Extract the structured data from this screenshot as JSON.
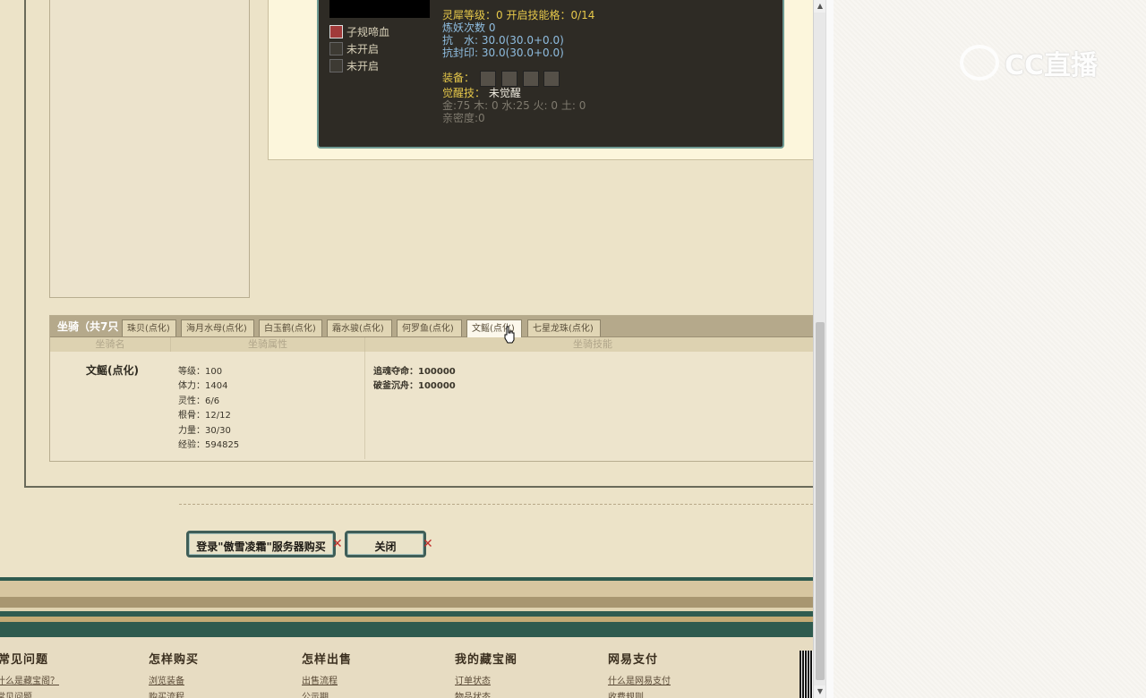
{
  "pet": {
    "skills": [
      {
        "label": "子规啼血",
        "icon": "blood-skill-icon"
      },
      {
        "label": "未开启",
        "icon": "locked-slot-icon"
      },
      {
        "label": "未开启",
        "icon": "locked-slot-icon"
      }
    ],
    "lingxi": "灵犀等级：0 开启技能格：0/14",
    "lianyao": "炼妖次数 0",
    "kang_shui_label": "抗　水:",
    "kang_shui_value": "30.0(30.0+0.0)",
    "kang_feng_label": "抗封印:",
    "kang_feng_value": "30.0(30.0+0.0)",
    "equip_label": "装备：",
    "awaken_label": "觉醒技：",
    "awaken_value": "未觉醒",
    "elements": "金:75 木: 0 水:25 火: 0 土: 0",
    "intimacy": "亲密度:0"
  },
  "mounts": {
    "section_title": "坐骑（共7只",
    "tabs": [
      "珠贝(点化)",
      "海月水母(点化)",
      "白玉鹤(点化)",
      "霜水骏(点化)",
      "何罗鱼(点化)",
      "文鳐(点化)",
      "七星龙珠(点化)"
    ],
    "active_tab": "文鳐(点化)",
    "col_name": "坐骑名",
    "col_attrs": "坐骑属性",
    "col_skills": "坐骑技能",
    "selected": {
      "name": "文鳐(点化)",
      "attrs": [
        "等级：100",
        "体力：1404",
        "灵性：6/6",
        "根骨：12/12",
        "力量：30/30",
        "经验：594825"
      ],
      "skills": [
        "追魂夺命：100000",
        "破釜沉舟：100000"
      ]
    }
  },
  "buttons": {
    "login_buy": "登录\"傲雪凌霜\"服务器购买",
    "close": "关闭"
  },
  "footer": {
    "columns": [
      {
        "head": "常见问题",
        "links": [
          "什么是藏宝阁？",
          "常见问题"
        ]
      },
      {
        "head": "怎样购买",
        "links": [
          "浏览装备",
          "购买流程"
        ]
      },
      {
        "head": "怎样出售",
        "links": [
          "出售流程",
          "公示期"
        ]
      },
      {
        "head": "我的藏宝阁",
        "links": [
          "订单状态",
          "物品状态"
        ]
      },
      {
        "head": "网易支付",
        "links": [
          "什么是网易支付",
          "收费规则"
        ]
      }
    ]
  },
  "watermark": "CC直播"
}
